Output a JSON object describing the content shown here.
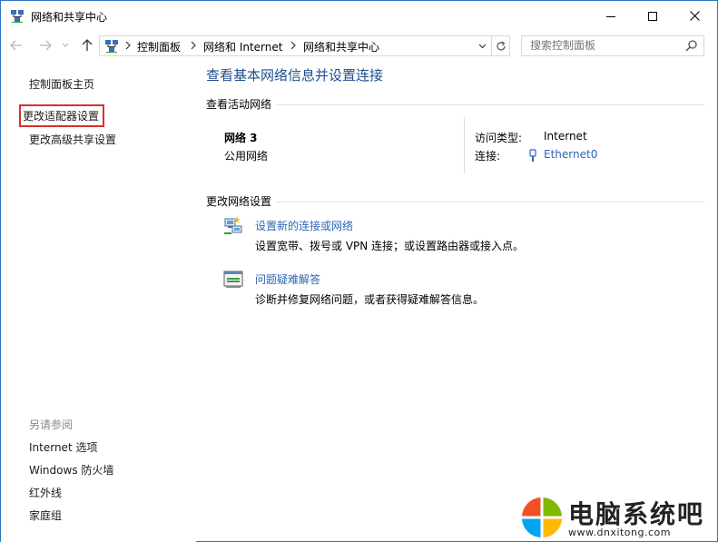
{
  "window": {
    "title": "网络和共享中心"
  },
  "address_bar": {
    "crumbs": [
      "控制面板",
      "网络和 Internet",
      "网络和共享中心"
    ],
    "search_placeholder": "搜索控制面板"
  },
  "left_pane": {
    "links": [
      "控制面板主页",
      "更改适配器设置",
      "更改高级共享设置"
    ],
    "see_also_label": "另请参阅",
    "see_also": [
      "Internet 选项",
      "Windows 防火墙",
      "红外线",
      "家庭组"
    ]
  },
  "main": {
    "title": "查看基本网络信息并设置连接",
    "active_networks_header": "查看活动网络",
    "network_name": "网络  3",
    "network_category": "公用网络",
    "access_type_label": "访问类型:",
    "access_type_value": "Internet",
    "connections_label": "连接:",
    "connections_value": "Ethernet0",
    "change_settings_header": "更改网络设置",
    "tasks": [
      {
        "link": "设置新的连接或网络",
        "desc": "设置宽带、拨号或 VPN 连接；或设置路由器或接入点。"
      },
      {
        "link": "问题疑难解答",
        "desc": "诊断并修复网络问题，或者获得疑难解答信息。"
      }
    ]
  },
  "watermark": {
    "title": "电脑系统吧",
    "url": "www.dnxitong.com"
  },
  "colors": {
    "link": "#2d65b8",
    "title": "#1e4e8c",
    "highlight_box": "#d9302b",
    "window_border": "#2b74c7"
  }
}
